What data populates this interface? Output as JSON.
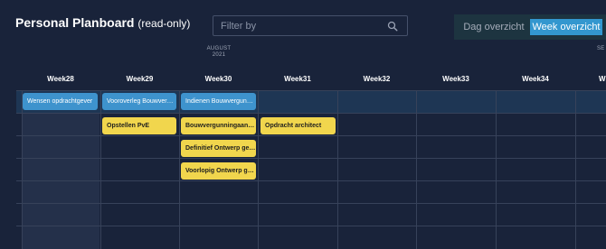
{
  "header": {
    "title": "Personal Planboard",
    "subtitle": "(read-only)",
    "filter_placeholder": "Filter by",
    "view_toggle": {
      "day_label": "Dag overzicht",
      "week_label": "Week overzicht",
      "active": "week"
    }
  },
  "timeline": {
    "months": [
      {
        "name": "AUGUST",
        "year": "2021"
      },
      {
        "name": "SE",
        "year": ""
      }
    ],
    "weeks": [
      "Week28",
      "Week29",
      "Week30",
      "Week31",
      "Week32",
      "Week33",
      "Week34",
      "W"
    ]
  },
  "tasks": [
    {
      "label": "Wensen opdrachtgever",
      "week": "Week28",
      "row": 1,
      "color": "blue"
    },
    {
      "label": "Vooroverleg Bouwvergunning",
      "week": "Week29",
      "row": 1,
      "color": "blue"
    },
    {
      "label": "Indienen Bouwvergunning",
      "week": "Week30",
      "row": 1,
      "color": "blue"
    },
    {
      "label": "Opstellen PvE",
      "week": "Week29",
      "row": 2,
      "color": "yellow"
    },
    {
      "label": "Bouwvergunningaanvraag",
      "week": "Week30",
      "row": 2,
      "color": "yellow"
    },
    {
      "label": "Opdracht architect",
      "week": "Week31",
      "row": 2,
      "color": "yellow"
    },
    {
      "label": "Definitief Ontwerp gereed",
      "week": "Week30",
      "row": 3,
      "color": "yellow"
    },
    {
      "label": "Voorlopig Ontwerp gereed",
      "week": "Week30",
      "row": 4,
      "color": "yellow"
    }
  ],
  "colors": {
    "background": "#19233a",
    "grid_line": "#37425a",
    "task_blue": "#3e93cd",
    "task_yellow": "#f1d64d",
    "toggle_active": "#3397cf"
  }
}
